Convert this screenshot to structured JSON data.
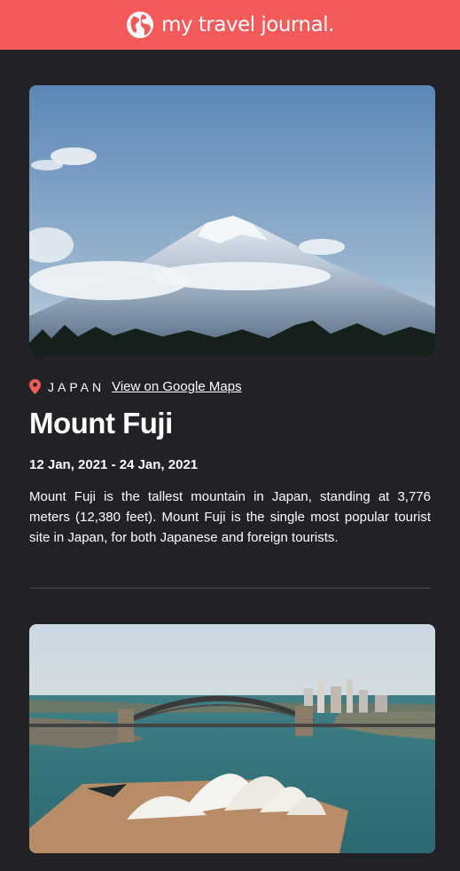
{
  "header": {
    "title": "my travel journal.",
    "icon": "globe-icon",
    "color": "#F55A5A"
  },
  "entries": [
    {
      "image_alt": "Mount Fuji",
      "country": "JAPAN",
      "maps_label": "View on Google Maps",
      "title": "Mount Fuji",
      "dates": "12 Jan, 2021 - 24 Jan, 2021",
      "description": "Mount Fuji is the tallest mountain in Japan, standing at 3,776 meters (12,380 feet). Mount Fuji is the single most popular tourist site in Japan, for both Japanese and foreign tourists."
    },
    {
      "image_alt": "Sydney Opera House"
    }
  ]
}
